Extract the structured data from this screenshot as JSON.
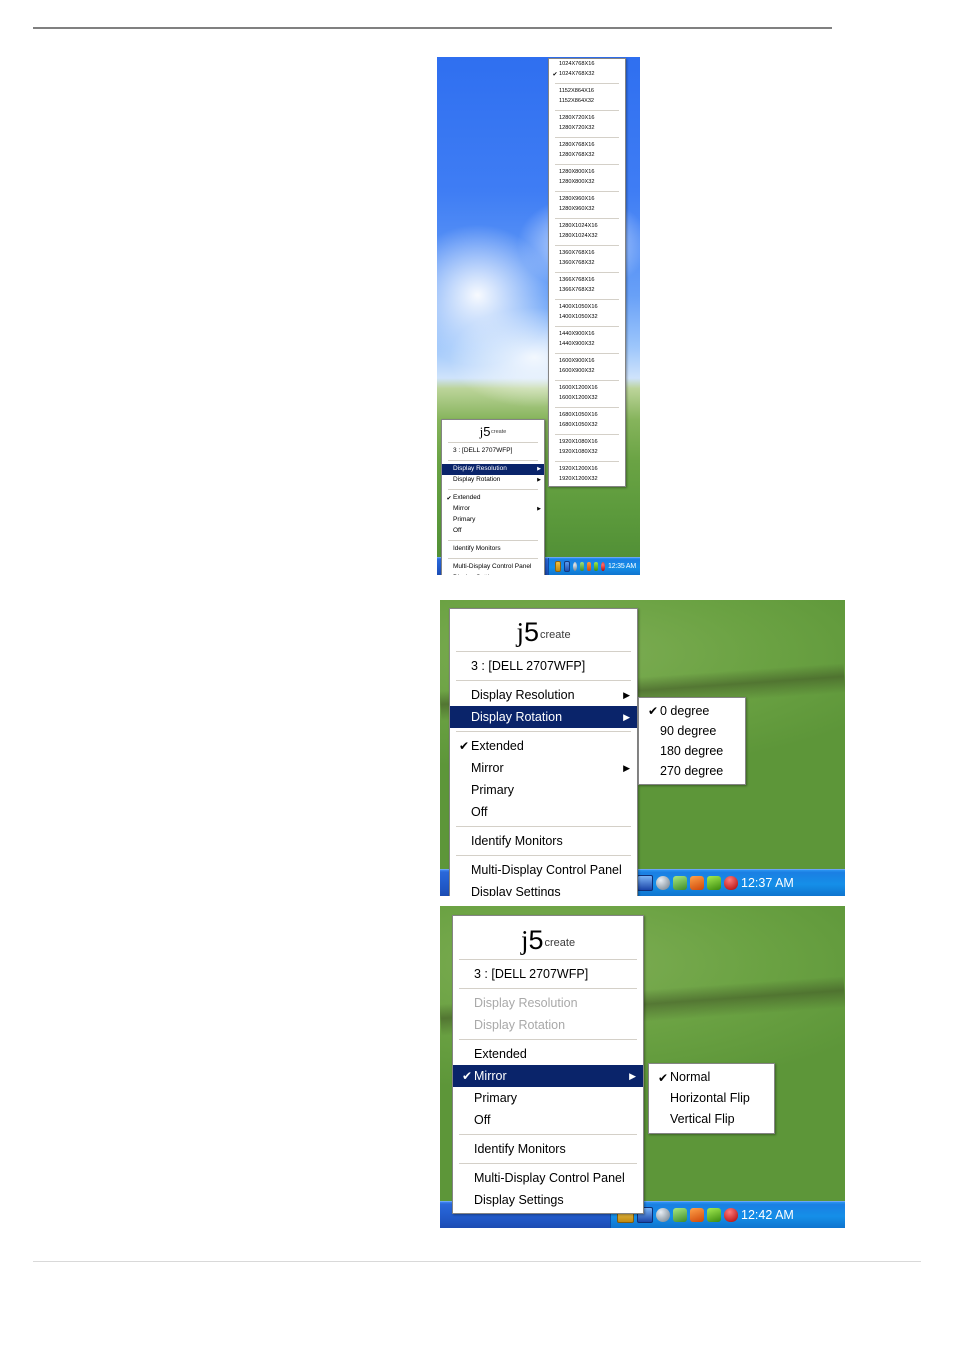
{
  "page": {
    "background": "#ffffff",
    "rule_top_color": "#808080",
    "rule_bottom_color": "#d9d9d9"
  },
  "brand": {
    "j": "j",
    "five": "5",
    "create": "create"
  },
  "menu": {
    "monitor_label": "3 : [DELL 2707WFP]",
    "display_resolution": "Display Resolution",
    "display_rotation": "Display Rotation",
    "extended": "Extended",
    "mirror": "Mirror",
    "primary": "Primary",
    "off": "Off",
    "identify_monitors": "Identify Monitors",
    "multi_display_control_panel": "Multi-Display Control Panel",
    "display_settings": "Display Settings",
    "check_glyph": "✔",
    "arrow_glyph": "▶"
  },
  "colors": {
    "menu_highlight": "#0a246a",
    "menu_highlight_text": "#ffffff",
    "menu_bg": "#ffffff",
    "menu_border": "#848484",
    "menu_disabled_text": "#a9a9a9",
    "taskbar_blue": "#245fd0",
    "tray_blue": "#158fe8"
  },
  "screenshot1": {
    "clock": "12:35 AM",
    "resolutions": [
      {
        "label": "1024X768X16",
        "checked": false,
        "group": 0
      },
      {
        "label": "1024X768X32",
        "checked": true,
        "group": 0
      },
      {
        "label": "1152X864X16",
        "checked": false,
        "group": 1
      },
      {
        "label": "1152X864X32",
        "checked": false,
        "group": 1
      },
      {
        "label": "1280X720X16",
        "checked": false,
        "group": 2
      },
      {
        "label": "1280X720X32",
        "checked": false,
        "group": 2
      },
      {
        "label": "1280X768X16",
        "checked": false,
        "group": 3
      },
      {
        "label": "1280X768X32",
        "checked": false,
        "group": 3
      },
      {
        "label": "1280X800X16",
        "checked": false,
        "group": 4
      },
      {
        "label": "1280X800X32",
        "checked": false,
        "group": 4
      },
      {
        "label": "1280X960X16",
        "checked": false,
        "group": 5
      },
      {
        "label": "1280X960X32",
        "checked": false,
        "group": 5
      },
      {
        "label": "1280X1024X16",
        "checked": false,
        "group": 6
      },
      {
        "label": "1280X1024X32",
        "checked": false,
        "group": 6
      },
      {
        "label": "1360X768X16",
        "checked": false,
        "group": 7
      },
      {
        "label": "1360X768X32",
        "checked": false,
        "group": 7
      },
      {
        "label": "1366X768X16",
        "checked": false,
        "group": 8
      },
      {
        "label": "1366X768X32",
        "checked": false,
        "group": 8
      },
      {
        "label": "1400X1050X16",
        "checked": false,
        "group": 9
      },
      {
        "label": "1400X1050X32",
        "checked": false,
        "group": 9
      },
      {
        "label": "1440X900X16",
        "checked": false,
        "group": 10
      },
      {
        "label": "1440X900X32",
        "checked": false,
        "group": 10
      },
      {
        "label": "1600X900X16",
        "checked": false,
        "group": 11
      },
      {
        "label": "1600X900X32",
        "checked": false,
        "group": 11
      },
      {
        "label": "1600X1200X16",
        "checked": false,
        "group": 12
      },
      {
        "label": "1600X1200X32",
        "checked": false,
        "group": 12
      },
      {
        "label": "1680X1050X16",
        "checked": false,
        "group": 13
      },
      {
        "label": "1680X1050X32",
        "checked": false,
        "group": 13
      },
      {
        "label": "1920X1080X16",
        "checked": false,
        "group": 14
      },
      {
        "label": "1920X1080X32",
        "checked": false,
        "group": 14
      },
      {
        "label": "1920X1200X16",
        "checked": false,
        "group": 15
      },
      {
        "label": "1920X1200X32",
        "checked": false,
        "group": 15
      }
    ]
  },
  "screenshot2": {
    "clock": "12:37 AM",
    "rotation_options": [
      {
        "label": "0 degree",
        "checked": true
      },
      {
        "label": "90 degree",
        "checked": false
      },
      {
        "label": "180 degree",
        "checked": false
      },
      {
        "label": "270 degree",
        "checked": false
      }
    ]
  },
  "screenshot3": {
    "clock": "12:42 AM",
    "mirror_options": [
      {
        "label": "Normal",
        "checked": true
      },
      {
        "label": "Horizontal Flip",
        "checked": false
      },
      {
        "label": "Vertical Flip",
        "checked": false
      }
    ]
  },
  "tray_icons": [
    "network-connection-icon",
    "j5-display-icon",
    "headset-icon",
    "bluetooth-icon",
    "volume-icon",
    "nvidia-icon",
    "security-shield-icon"
  ]
}
